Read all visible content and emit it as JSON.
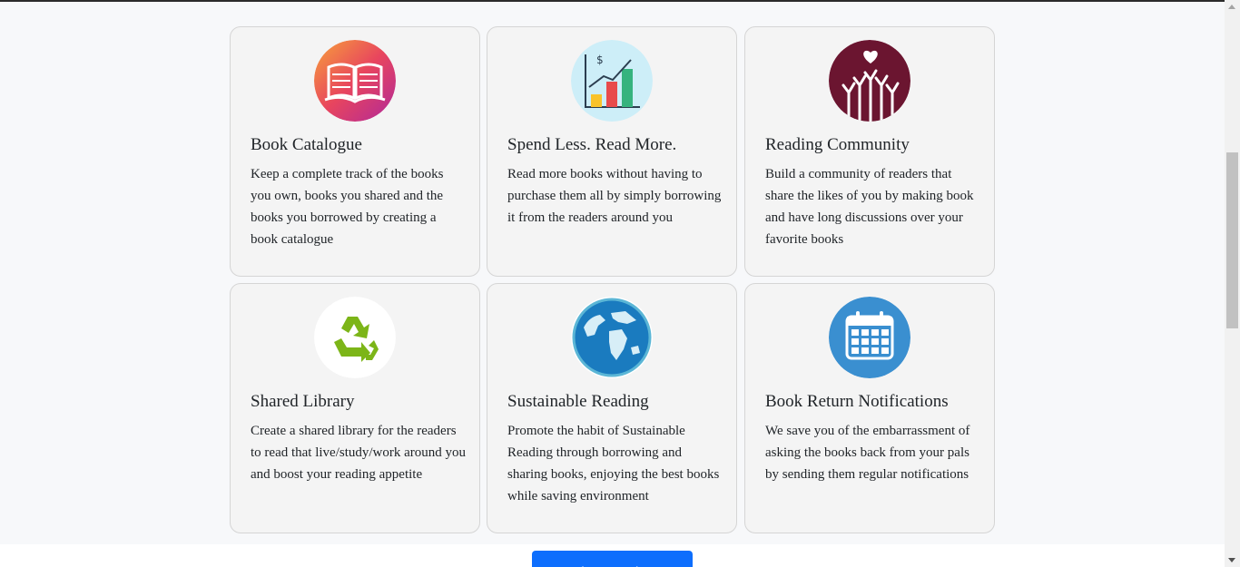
{
  "features": [
    {
      "title": "Book Catalogue",
      "text": "Keep a complete track of the books you own, books you shared and the books you borrowed by creating a book catalogue",
      "icon": "open-book-icon"
    },
    {
      "title": "Spend Less. Read More.",
      "text": "Read more books without having to purchase them all by simply borrowing it from the readers around you",
      "icon": "bar-chart-icon"
    },
    {
      "title": "Reading Community",
      "text": "Build a community of readers that share the likes of you by making book and have long discussions over your favorite books",
      "icon": "raised-hands-icon"
    },
    {
      "title": "Shared Library",
      "text": "Create a shared library for the readers to read that live/study/work around you and boost your reading appetite",
      "icon": "recycle-icon"
    },
    {
      "title": "Sustainable Reading",
      "text": "Promote the habit of Sustainable Reading through borrowing and sharing books, enjoying the best books while saving environment",
      "icon": "globe-icon"
    },
    {
      "title": "Book Return Notifications",
      "text": "We save you of the embarrassment of asking the books back from your pals by sending them regular notifications",
      "icon": "calendar-icon"
    }
  ],
  "cta": {
    "label": "Explore Books  →"
  },
  "colors": {
    "accent": "#0d6efd",
    "card_bg": "#f4f4f4",
    "section_bg": "#f7f8fa"
  }
}
